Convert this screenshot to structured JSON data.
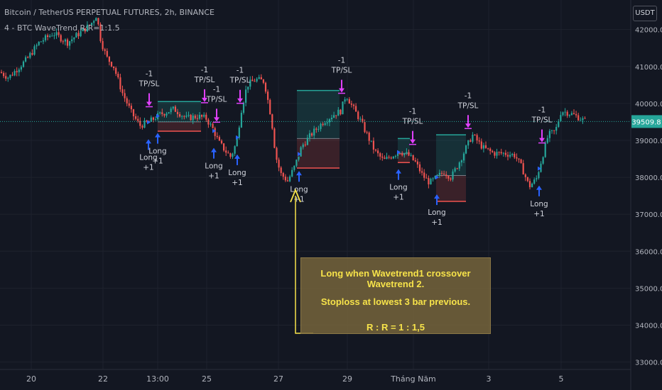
{
  "header": {
    "symbol_line": "Bitcoin / TetherUS PERPETUAL FUTURES, 2h, BINANCE",
    "indicator_line": "4 - BTC WaveTrend R:R=1:1.5",
    "currency": "USDT"
  },
  "annotation": {
    "line1": "Long when Wavetrend1 crossover Wavetrend 2.",
    "line2": "Stoploss at lowest 3 bar previous.",
    "line3": "R : R = 1 : 1,5"
  },
  "colors": {
    "background": "#131722",
    "grid": "#1e222d",
    "up_candle": "#26a69a",
    "down_candle": "#ef5350",
    "long_arrow": "#2962ff",
    "exit_arrow": "#e040fb",
    "current_price_line": "#26a69a",
    "annotation_text": "#f7e34a",
    "annotation_arrow": "#f7e34a"
  },
  "chart_data": {
    "type": "candlestick",
    "ylim": [
      32800,
      42800
    ],
    "y_ticks": [
      "42000.0",
      "41000.0",
      "40000.0",
      "39000.0",
      "38000.0",
      "37000.0",
      "36000.0",
      "35000.0",
      "34000.0",
      "33000.0"
    ],
    "x_ticks": [
      "20",
      "22",
      "13:00",
      "25",
      "27",
      "29",
      "Tháng Năm",
      "3",
      "5"
    ],
    "current_price": "39509.8",
    "price_path": [
      [
        0,
        40850
      ],
      [
        12,
        40700
      ],
      [
        25,
        40950
      ],
      [
        38,
        41200
      ],
      [
        55,
        41650
      ],
      [
        75,
        41900
      ],
      [
        95,
        41650
      ],
      [
        115,
        41950
      ],
      [
        128,
        42150
      ],
      [
        136,
        42400
      ],
      [
        142,
        41700
      ],
      [
        150,
        41250
      ],
      [
        160,
        41000
      ],
      [
        172,
        40300
      ],
      [
        185,
        39750
      ],
      [
        197,
        39400
      ],
      [
        210,
        39500
      ],
      [
        225,
        39700
      ],
      [
        245,
        39850
      ],
      [
        262,
        39600
      ],
      [
        278,
        39650
      ],
      [
        290,
        39600
      ],
      [
        300,
        39300
      ],
      [
        308,
        38950
      ],
      [
        318,
        38700
      ],
      [
        325,
        38550
      ],
      [
        333,
        38950
      ],
      [
        340,
        39850
      ],
      [
        348,
        40500
      ],
      [
        360,
        40650
      ],
      [
        372,
        40600
      ],
      [
        382,
        39600
      ],
      [
        388,
        38600
      ],
      [
        395,
        38100
      ],
      [
        405,
        37900
      ],
      [
        415,
        38300
      ],
      [
        425,
        38850
      ],
      [
        440,
        39200
      ],
      [
        455,
        39500
      ],
      [
        470,
        39700
      ],
      [
        480,
        39800
      ],
      [
        487,
        40250
      ],
      [
        495,
        39950
      ],
      [
        507,
        39550
      ],
      [
        518,
        39100
      ],
      [
        528,
        38700
      ],
      [
        540,
        38450
      ],
      [
        553,
        38600
      ],
      [
        563,
        38700
      ],
      [
        575,
        38600
      ],
      [
        585,
        38400
      ],
      [
        595,
        38050
      ],
      [
        605,
        37850
      ],
      [
        615,
        38000
      ],
      [
        625,
        38150
      ],
      [
        635,
        38000
      ],
      [
        645,
        38350
      ],
      [
        655,
        38750
      ],
      [
        665,
        39150
      ],
      [
        680,
        38800
      ],
      [
        695,
        38650
      ],
      [
        710,
        38650
      ],
      [
        725,
        38600
      ],
      [
        735,
        38250
      ],
      [
        745,
        37750
      ],
      [
        755,
        37950
      ],
      [
        762,
        38450
      ],
      [
        772,
        39150
      ],
      [
        782,
        39250
      ],
      [
        790,
        39800
      ],
      [
        800,
        39750
      ],
      [
        812,
        39650
      ],
      [
        824,
        39520
      ]
    ],
    "long_signals": [
      {
        "x": 209,
        "label": "Long",
        "sub": "+1"
      },
      {
        "x": 222,
        "label": "Long",
        "sub": "+1"
      },
      {
        "x": 301,
        "label": "Long",
        "sub": "+1"
      },
      {
        "x": 334,
        "label": "Long",
        "sub": "+1"
      },
      {
        "x": 421,
        "label": "Long",
        "sub": "+1"
      },
      {
        "x": 561,
        "label": "Long",
        "sub": "+1"
      },
      {
        "x": 615,
        "label": "Long",
        "sub": "+1"
      },
      {
        "x": 759,
        "label": "Long",
        "sub": "+1"
      }
    ],
    "exit_signals": [
      {
        "x": 210,
        "label": "-1",
        "sub": "TP/SL"
      },
      {
        "x": 288,
        "label": "-1",
        "sub": "TP/SL"
      },
      {
        "x": 305,
        "label": "-1",
        "sub": "TP/SL"
      },
      {
        "x": 338,
        "label": "-1",
        "sub": "TP/SL"
      },
      {
        "x": 481,
        "label": "-1",
        "sub": "TP/SL"
      },
      {
        "x": 581,
        "label": "-1",
        "sub": "TP/SL"
      },
      {
        "x": 659,
        "label": "-1",
        "sub": "TP/SL"
      },
      {
        "x": 763,
        "label": "-1",
        "sub": "TP/SL"
      }
    ],
    "trade_boxes": [
      {
        "x1": 222,
        "x2": 283,
        "entry": 39500,
        "tp": 40050,
        "sl": 39250
      },
      {
        "x1": 418,
        "x2": 478,
        "entry": 39050,
        "tp": 40350,
        "sl": 38250
      },
      {
        "x1": 560,
        "x2": 577,
        "entry": 38650,
        "tp": 39050,
        "sl": 38400
      },
      {
        "x1": 614,
        "x2": 656,
        "entry": 38050,
        "tp": 39150,
        "sl": 37350
      }
    ]
  }
}
